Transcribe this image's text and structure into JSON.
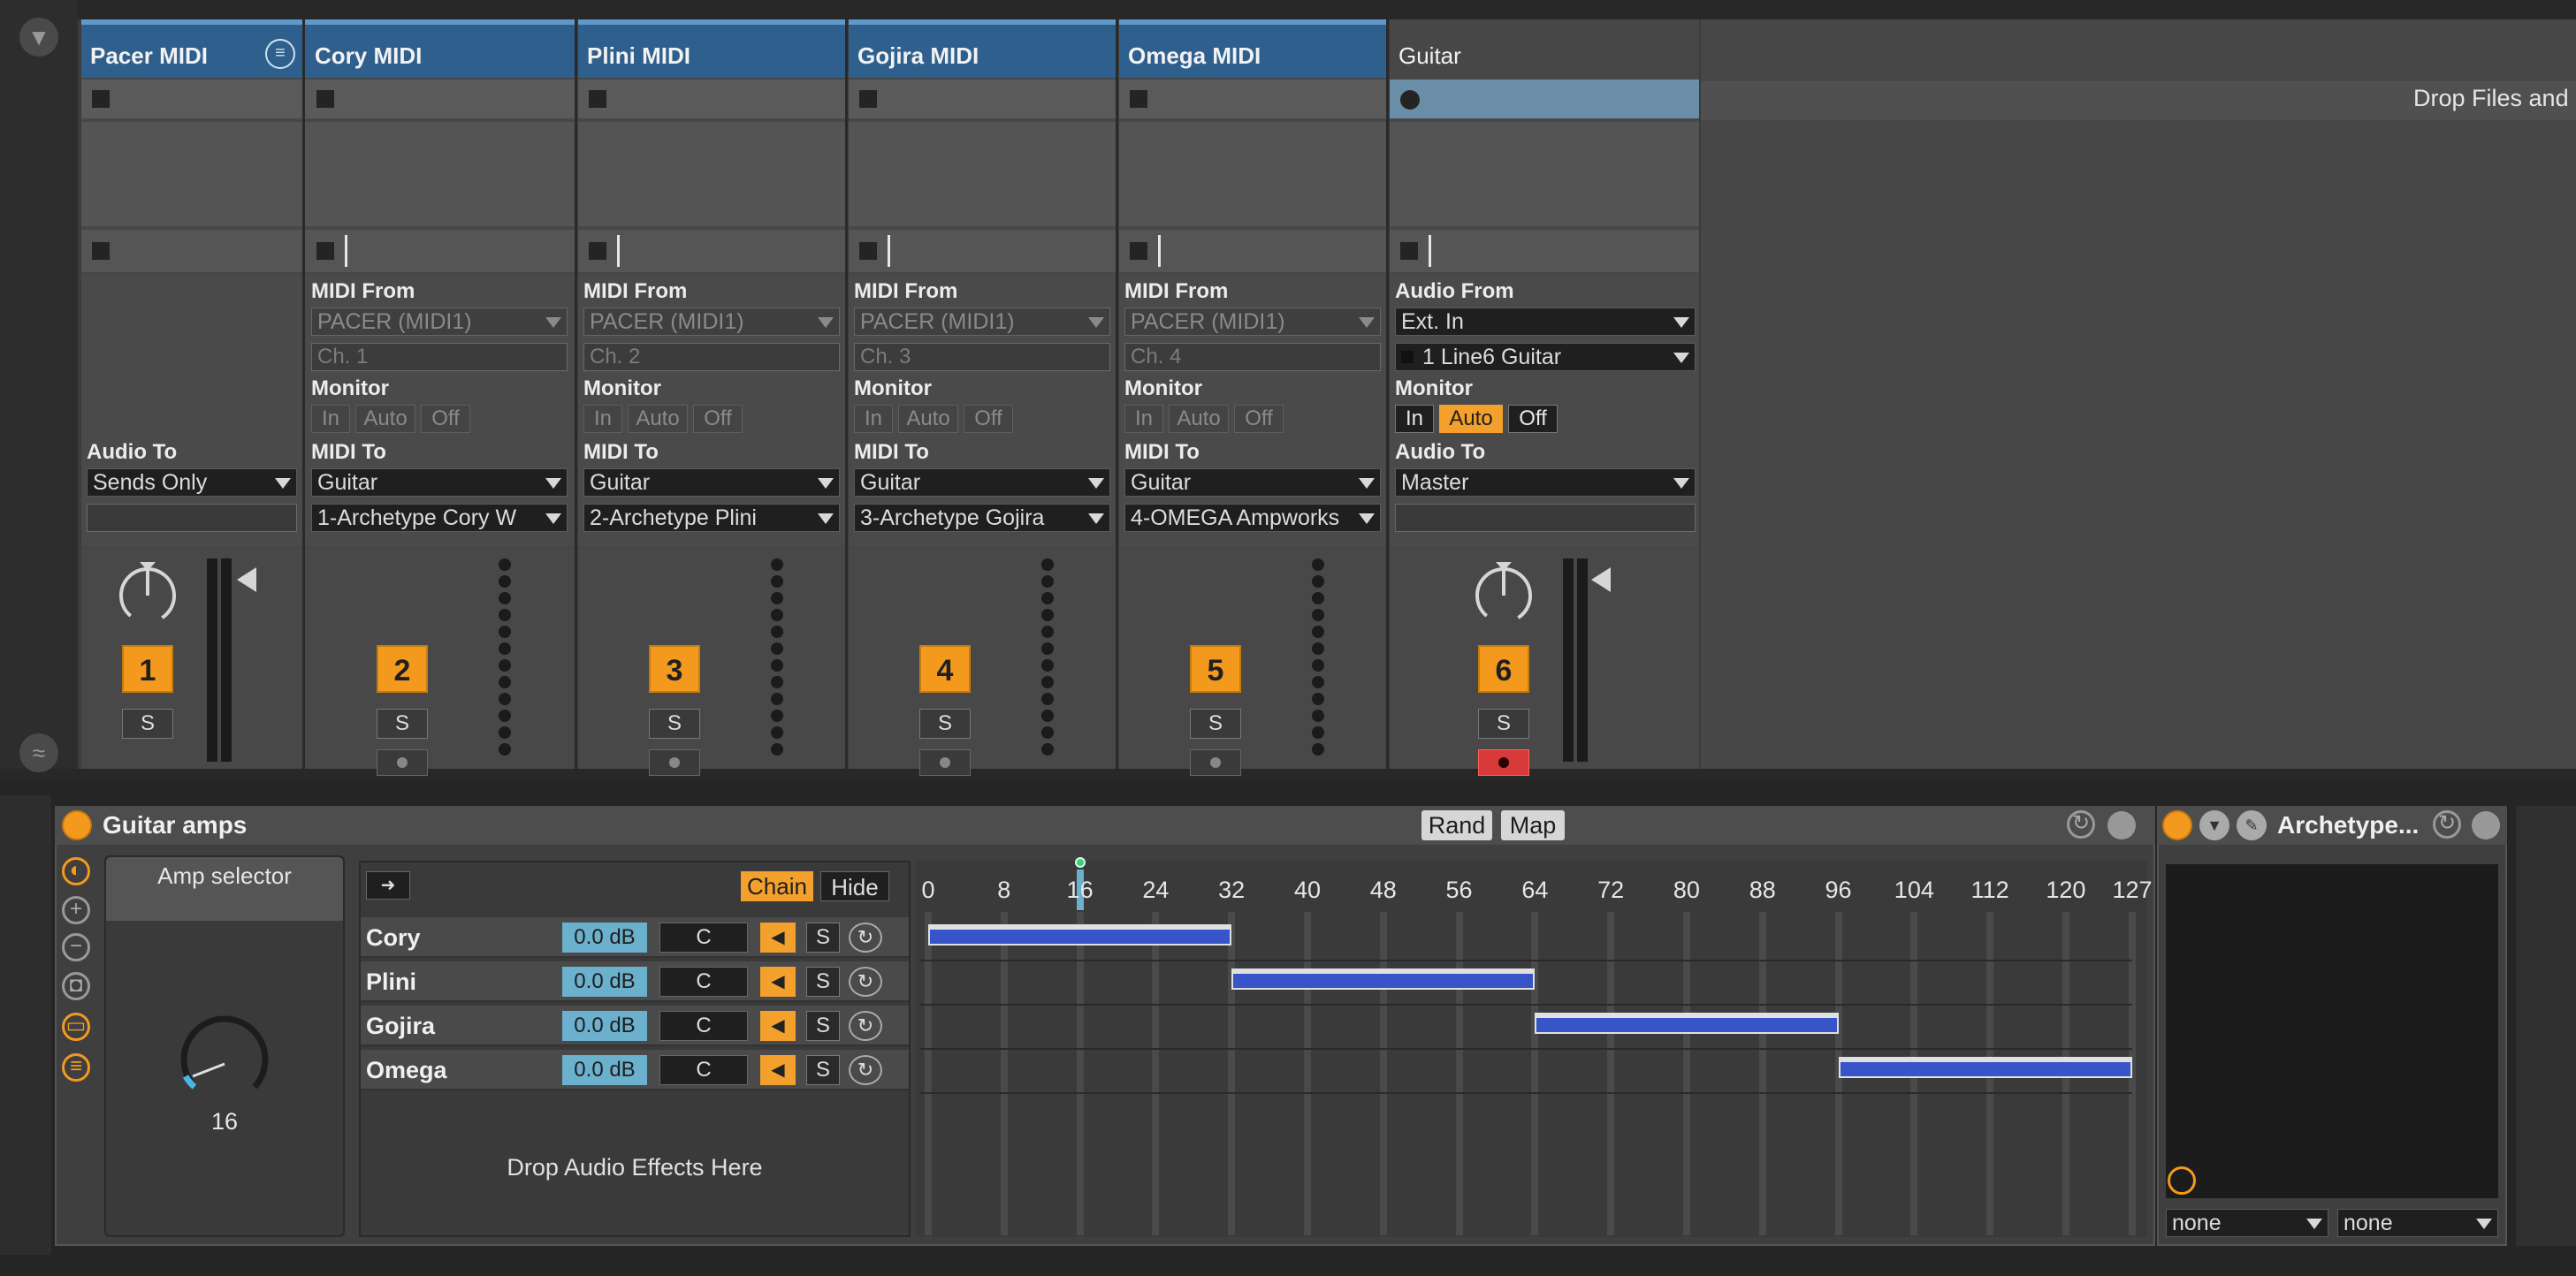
{
  "tracks": [
    {
      "name": "Pacer MIDI",
      "number": "1"
    },
    {
      "name": "Cory MIDI",
      "number": "2",
      "midi_from": "PACER (MIDI1)",
      "channel": "Ch. 1",
      "midi_to": "Guitar",
      "midi_to_target": "1-Archetype Cory W"
    },
    {
      "name": "Plini MIDI",
      "number": "3",
      "midi_from": "PACER (MIDI1)",
      "channel": "Ch. 2",
      "midi_to": "Guitar",
      "midi_to_target": "2-Archetype Plini"
    },
    {
      "name": "Gojira MIDI",
      "number": "4",
      "midi_from": "PACER (MIDI1)",
      "channel": "Ch. 3",
      "midi_to": "Guitar",
      "midi_to_target": "3-Archetype Gojira"
    },
    {
      "name": "Omega MIDI",
      "number": "5",
      "midi_from": "PACER (MIDI1)",
      "channel": "Ch. 4",
      "midi_to": "Guitar",
      "midi_to_target": "4-OMEGA Ampworks"
    },
    {
      "name": "Guitar",
      "number": "6",
      "audio_from": "Ext. In",
      "input_channel": "1 Line6 Guitar",
      "audio_to": "Master"
    }
  ],
  "labels": {
    "midi_from": "MIDI From",
    "midi_to": "MIDI To",
    "monitor": "Monitor",
    "audio_from": "Audio From",
    "audio_to": "Audio To",
    "mon_in": "In",
    "mon_auto": "Auto",
    "mon_off": "Off",
    "solo": "S"
  },
  "pacer_audio_to": "Sends Only",
  "drop_files": "Drop Files and",
  "device": {
    "title": "Guitar amps",
    "rand": "Rand",
    "map": "Map",
    "macro_title": "Amp selector",
    "macro_value": "16",
    "chain_btn": "Chain",
    "hide_btn": "Hide",
    "drop_effects": "Drop Audio Effects Here",
    "chains": [
      {
        "name": "Cory",
        "volume": "0.0 dB",
        "pan": "C",
        "zone": [
          0,
          31
        ]
      },
      {
        "name": "Plini",
        "volume": "0.0 dB",
        "pan": "C",
        "zone": [
          32,
          63
        ]
      },
      {
        "name": "Gojira",
        "volume": "0.0 dB",
        "pan": "C",
        "zone": [
          64,
          95
        ]
      },
      {
        "name": "Omega",
        "volume": "0.0 dB",
        "pan": "C",
        "zone": [
          96,
          127
        ]
      }
    ],
    "ruler": [
      "0",
      "8",
      "16",
      "24",
      "32",
      "40",
      "48",
      "56",
      "64",
      "72",
      "80",
      "88",
      "96",
      "104",
      "112",
      "120",
      "127"
    ],
    "selector_value": 16
  },
  "plugin": {
    "title": "Archetype...",
    "select_left": "none",
    "select_right": "none"
  },
  "colors": {
    "accent": "#f39a1e",
    "track_header": "#2f5f8c",
    "zone": "#3754c8",
    "selected_clip": "#6b8ea8"
  }
}
